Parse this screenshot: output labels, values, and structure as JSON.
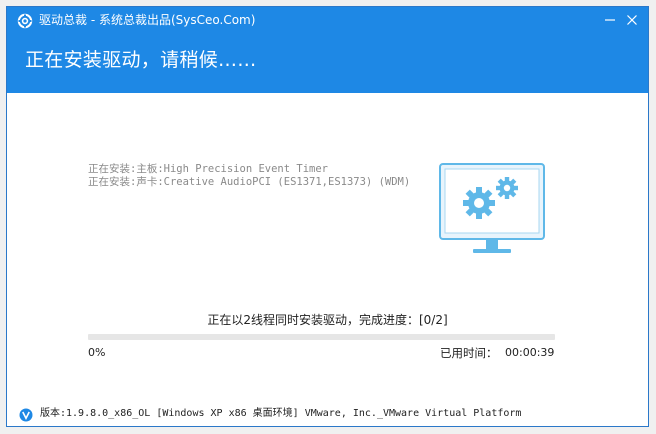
{
  "window": {
    "title": "驱动总裁 - 系统总裁出品(SysCeo.Com)",
    "heading": "正在安装驱动，请稍候……"
  },
  "install_lines": [
    "正在安装:主板:High Precision Event Timer",
    "正在安装:声卡:Creative AudioPCI (ES1371,ES1373) (WDM)"
  ],
  "progress": {
    "status": "正在以2线程同时安装驱动，完成进度：[0/2]",
    "percent_label": "0%",
    "fraction": 0,
    "elapsed_label": "已用时间：",
    "elapsed_value": "00:00:39"
  },
  "footer": {
    "version_text": "版本:1.9.8.0_x86_OL [Windows XP x86 桌面环境] VMware, Inc._VMware Virtual Platform"
  },
  "colors": {
    "accent": "#1e88e5",
    "monitor_screen": "#e8f4fc",
    "gear": "#5fb8e8"
  },
  "icons": {
    "app": "app-logo-icon",
    "minimize": "minimize-icon",
    "close": "close-icon",
    "monitor": "monitor-gears-icon",
    "footer": "version-badge-icon"
  }
}
